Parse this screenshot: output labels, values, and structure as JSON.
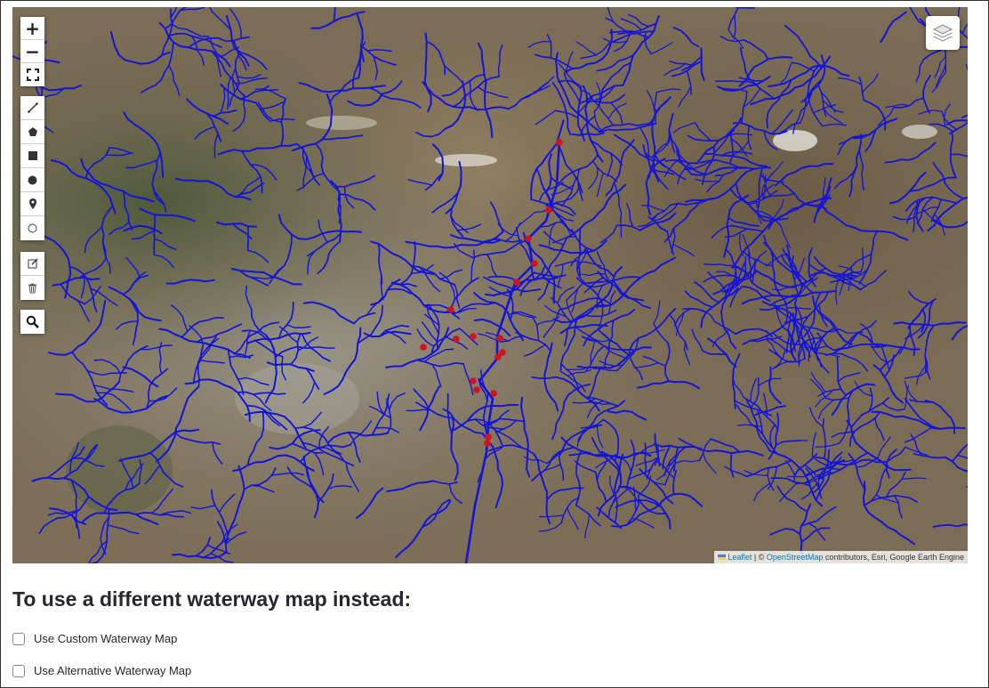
{
  "map": {
    "controls": {
      "zoom_in": "+",
      "zoom_out": "−",
      "fullscreen_icon": "fullscreen-icon",
      "draw_tools": [
        "polyline-icon",
        "polygon-icon",
        "rectangle-icon",
        "circle-icon",
        "marker-icon",
        "circlemarker-icon"
      ],
      "edit_tools": [
        "edit-icon",
        "trash-icon"
      ],
      "search_icon": "search-icon",
      "layers_icon": "layers-icon"
    },
    "attribution": {
      "leaflet": "Leaflet",
      "sep": " | © ",
      "osm": "OpenStreetMap",
      "rest": " contributors, Esri, Google Earth Engine"
    },
    "colors": {
      "waterway": "#1414d8",
      "points": "#d0141e"
    }
  },
  "section": {
    "title": "To use a different waterway map instead:",
    "options": [
      {
        "label": "Use Custom Waterway Map",
        "checked": false
      },
      {
        "label": "Use Alternative Waterway Map",
        "checked": false
      }
    ]
  }
}
